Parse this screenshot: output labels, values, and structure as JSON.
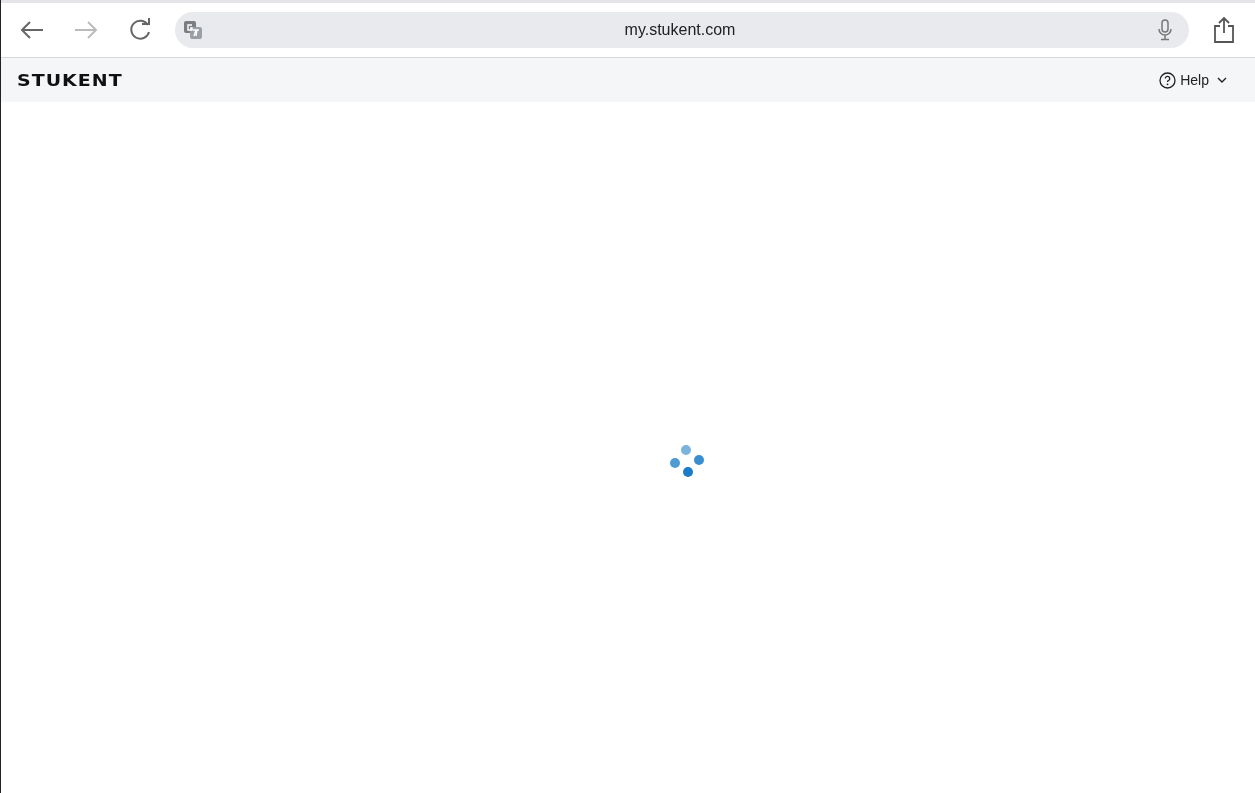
{
  "browser": {
    "url": "my.stukent.com",
    "back_enabled": true,
    "forward_enabled": false
  },
  "header": {
    "logo": "STUKENT",
    "help": {
      "label": "Help"
    }
  },
  "content": {
    "loading": true
  }
}
